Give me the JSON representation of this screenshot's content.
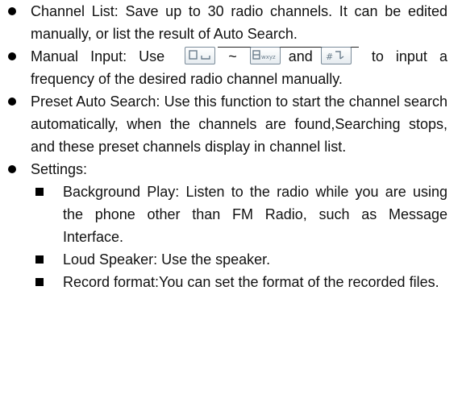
{
  "items": [
    {
      "text": "Channel List: Save up to 30 radio channels. It can be edited manually, or list the result of Auto Search."
    },
    {
      "text_before": "Manual Input: Use",
      "tilde": "~",
      "and_word": "and",
      "text_after": "to input a frequency of the desired radio channel manually.",
      "key_icons": [
        "zero-space-key-icon",
        "nine-wxyz-key-icon",
        "hash-key-icon"
      ],
      "key_label_wxyz": "wxyz"
    },
    {
      "text": "Preset Auto Search: Use this function to start the channel search automatically, when the channels are found,Searching stops, and these preset channels display in channel list."
    },
    {
      "text": "Settings:",
      "sub": [
        {
          "text": "Background Play: Listen to the radio while you are using the phone other than FM Radio, such as Message Interface."
        },
        {
          "text": "Loud Speaker: Use the speaker."
        },
        {
          "text": "Record format:You can set the format of the recorded files."
        }
      ]
    }
  ]
}
